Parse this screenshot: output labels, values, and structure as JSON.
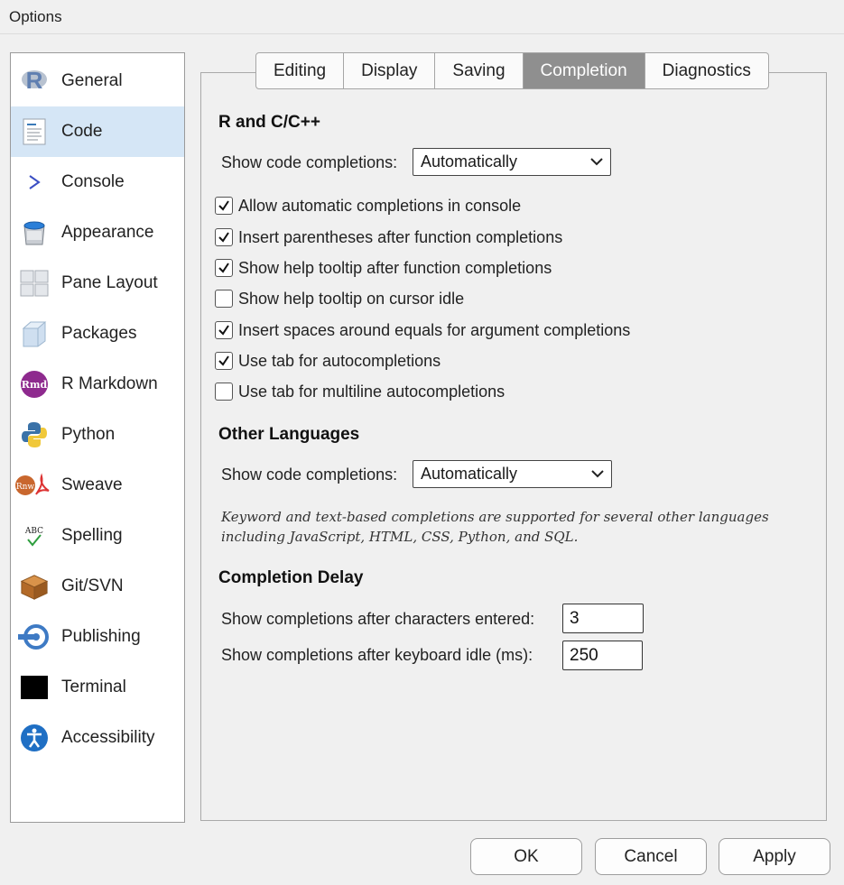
{
  "window": {
    "title": "Options"
  },
  "sidebar": {
    "items": [
      {
        "label": "General",
        "icon": "r-logo-icon"
      },
      {
        "label": "Code",
        "icon": "code-document-icon"
      },
      {
        "label": "Console",
        "icon": "console-prompt-icon"
      },
      {
        "label": "Appearance",
        "icon": "paint-bucket-icon"
      },
      {
        "label": "Pane Layout",
        "icon": "pane-grid-icon"
      },
      {
        "label": "Packages",
        "icon": "package-box-icon"
      },
      {
        "label": "R Markdown",
        "icon": "rmd-icon"
      },
      {
        "label": "Python",
        "icon": "python-icon"
      },
      {
        "label": "Sweave",
        "icon": "sweave-icon"
      },
      {
        "label": "Spelling",
        "icon": "spelling-check-icon"
      },
      {
        "label": "Git/SVN",
        "icon": "git-box-icon"
      },
      {
        "label": "Publishing",
        "icon": "publishing-icon"
      },
      {
        "label": "Terminal",
        "icon": "terminal-icon"
      },
      {
        "label": "Accessibility",
        "icon": "accessibility-icon"
      }
    ],
    "selected": "Code"
  },
  "tabs": [
    {
      "label": "Editing"
    },
    {
      "label": "Display"
    },
    {
      "label": "Saving"
    },
    {
      "label": "Completion"
    },
    {
      "label": "Diagnostics"
    }
  ],
  "active_tab": "Completion",
  "r_section": {
    "title": "R and C/C++",
    "completions_label": "Show code completions:",
    "completions_value": "Automatically",
    "checkboxes": [
      {
        "label": "Allow automatic completions in console",
        "checked": true
      },
      {
        "label": "Insert parentheses after function completions",
        "checked": true
      },
      {
        "label": "Show help tooltip after function completions",
        "checked": true
      },
      {
        "label": "Show help tooltip on cursor idle",
        "checked": false
      },
      {
        "label": "Insert spaces around equals for argument completions",
        "checked": true
      },
      {
        "label": "Use tab for autocompletions",
        "checked": true
      },
      {
        "label": "Use tab for multiline autocompletions",
        "checked": false
      }
    ]
  },
  "other_section": {
    "title": "Other Languages",
    "completions_label": "Show code completions:",
    "completions_value": "Automatically",
    "note": "Keyword and text-based completions are supported for several other languages including JavaScript, HTML, CSS, Python, and SQL."
  },
  "delay_section": {
    "title": "Completion Delay",
    "chars_label": "Show completions after characters entered:",
    "chars_value": "3",
    "idle_label": "Show completions after keyboard idle (ms):",
    "idle_value": "250"
  },
  "buttons": {
    "ok": "OK",
    "cancel": "Cancel",
    "apply": "Apply"
  },
  "colors": {
    "selected_sidebar": "#d5e6f6",
    "active_tab": "#8f8f8f",
    "background": "#f0f0f0"
  }
}
